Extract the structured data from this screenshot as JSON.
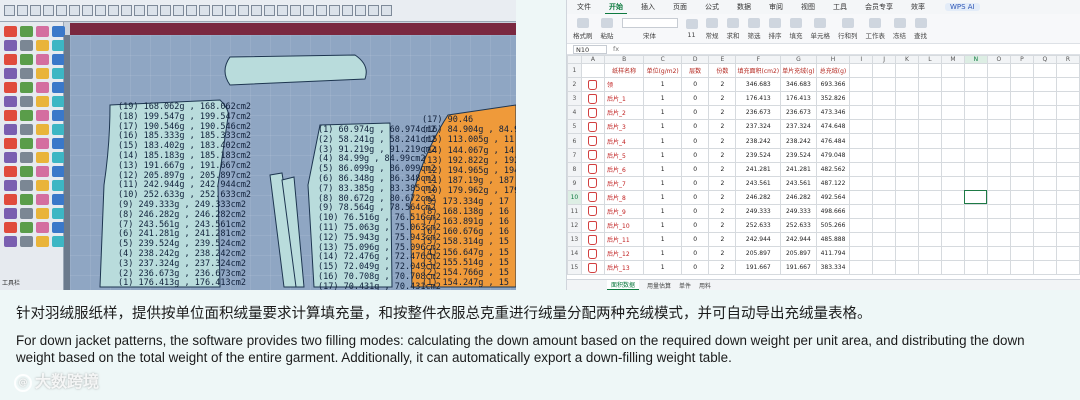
{
  "cad": {
    "status_text": "工具栏",
    "panel_a_rows": [
      "(19) 168.062g , 168.062cm2",
      "(18) 199.547g , 199.547cm2",
      "(17) 190.546g , 190.546cm2",
      "(16) 185.333g , 185.333cm2",
      "(15) 183.402g , 183.402cm2",
      "(14) 185.183g , 185.183cm2",
      "(13) 191.667g , 191.667cm2",
      "(12) 205.897g , 205.897cm2",
      "(11) 242.944g , 242.944cm2",
      "(10) 252.633g , 252.633cm2",
      "(9) 249.333g , 249.333cm2",
      "(8) 246.282g , 246.282cm2",
      "(7) 243.561g , 243.561cm2",
      "(6) 241.281g , 241.281cm2",
      "(5) 239.524g , 239.524cm2",
      "(4) 238.242g , 238.242cm2",
      "(3) 237.324g , 237.324cm2",
      "(2) 236.673g , 236.673cm2",
      "(1) 176.413g , 176.413cm2"
    ],
    "panel_b_rows": [
      "(1) 60.974g , 60.974cm2",
      "(2) 58.241g , 58.241cm2",
      "(3) 91.219g , 91.219cm2",
      "(4) 84.99g , 84.99cm2",
      "(5) 86.099g , 86.099cm2",
      "(6) 86.348g , 86.348cm2",
      "(7) 83.385g , 83.385cm2",
      "(8) 80.672g , 80.672cm2",
      "(9) 78.564g , 78.564cm2",
      "(10) 76.516g , 76.516cm2",
      "(11) 75.063g , 75.063cm2",
      "(12) 75.943g , 75.943cm2",
      "(13) 75.096g , 75.096cm2",
      "(14) 72.476g , 72.476cm2",
      "(15) 72.049g , 72.049cm2",
      "(16) 70.708g , 70.708cm2",
      "(17) 70.431g , 70.431cm2"
    ],
    "panel_c_rows": [
      "(17) 90.46",
      "(16) 84.904g , 84.9",
      "(15) 113.005g , 11",
      "(14) 144.067g , 14",
      "(13) 192.822g , 192",
      "(12) 194.965g , 194",
      "(11) 187.19g , 187",
      "(10) 179.962g , 179",
      "(9) 173.334g , 17",
      "(8) 168.138g , 16",
      "(7) 163.891g , 16",
      "(6) 160.676g , 16",
      "(5) 158.314g , 15",
      "(4) 156.647g , 15",
      "(3) 155.514g , 15",
      "(2) 154.766g , 15",
      "(1) 154.247g , 15"
    ]
  },
  "sheet": {
    "title_tabs": [
      "文件",
      "开始",
      "插入",
      "页面",
      "公式",
      "数据",
      "审阅",
      "视图",
      "工具",
      "会员专享",
      "效率"
    ],
    "active_tab": "开始",
    "wps_label": "WPS AI",
    "ribbon_labels": [
      "格式刷",
      "粘贴",
      "宋体",
      "11",
      "常规",
      "求和",
      "筛选",
      "排序",
      "填充",
      "单元格",
      "行和列",
      "工作表",
      "冻结",
      "查找"
    ],
    "name_box": "N10",
    "fx": "fx",
    "col_headers": [
      "A",
      "B",
      "C",
      "D",
      "E",
      "F",
      "G",
      "H",
      "I",
      "J",
      "K",
      "L",
      "M",
      "N",
      "O",
      "P",
      "Q",
      "R"
    ],
    "selected_col": "N",
    "selected_row": "10",
    "table_header": [
      "纸样名称",
      "单位(g/m2)",
      "层数",
      "份数",
      "填充面积(cm2)",
      "单片充绒(g)",
      "总充绒(g)"
    ],
    "rows": [
      {
        "num": "2",
        "name": "领",
        "unit": "1",
        "layer": "0",
        "copies": "2",
        "area": "346.683",
        "single": "346.683",
        "total": "693.366"
      },
      {
        "num": "3",
        "name": "后片_1",
        "unit": "1",
        "layer": "0",
        "copies": "2",
        "area": "176.413",
        "single": "176.413",
        "total": "352.826"
      },
      {
        "num": "4",
        "name": "后片_2",
        "unit": "1",
        "layer": "0",
        "copies": "2",
        "area": "236.673",
        "single": "236.673",
        "total": "473.346"
      },
      {
        "num": "5",
        "name": "后片_3",
        "unit": "1",
        "layer": "0",
        "copies": "2",
        "area": "237.324",
        "single": "237.324",
        "total": "474.648"
      },
      {
        "num": "6",
        "name": "后片_4",
        "unit": "1",
        "layer": "0",
        "copies": "2",
        "area": "238.242",
        "single": "238.242",
        "total": "476.484"
      },
      {
        "num": "7",
        "name": "后片_5",
        "unit": "1",
        "layer": "0",
        "copies": "2",
        "area": "239.524",
        "single": "239.524",
        "total": "479.048"
      },
      {
        "num": "8",
        "name": "后片_6",
        "unit": "1",
        "layer": "0",
        "copies": "2",
        "area": "241.281",
        "single": "241.281",
        "total": "482.562"
      },
      {
        "num": "9",
        "name": "后片_7",
        "unit": "1",
        "layer": "0",
        "copies": "2",
        "area": "243.561",
        "single": "243.561",
        "total": "487.122"
      },
      {
        "num": "10",
        "name": "后片_8",
        "unit": "1",
        "layer": "0",
        "copies": "2",
        "area": "246.282",
        "single": "246.282",
        "total": "492.564"
      },
      {
        "num": "11",
        "name": "后片_9",
        "unit": "1",
        "layer": "0",
        "copies": "2",
        "area": "249.333",
        "single": "249.333",
        "total": "498.666"
      },
      {
        "num": "12",
        "name": "后片_10",
        "unit": "1",
        "layer": "0",
        "copies": "2",
        "area": "252.633",
        "single": "252.633",
        "total": "505.266"
      },
      {
        "num": "13",
        "name": "后片_11",
        "unit": "1",
        "layer": "0",
        "copies": "2",
        "area": "242.944",
        "single": "242.944",
        "total": "485.888"
      },
      {
        "num": "14",
        "name": "后片_12",
        "unit": "1",
        "layer": "0",
        "copies": "2",
        "area": "205.897",
        "single": "205.897",
        "total": "411.794"
      },
      {
        "num": "15",
        "name": "后片_13",
        "unit": "1",
        "layer": "0",
        "copies": "2",
        "area": "191.667",
        "single": "191.667",
        "total": "383.334"
      }
    ],
    "sheet_tabs": [
      "面积数据",
      "用量估算",
      "单件",
      "用料"
    ],
    "active_sheet": "面积数据"
  },
  "caption": {
    "zh": "针对羽绒服纸样，提供按单位面积绒量要求计算填充量，和按整件衣服总克重进行绒量分配两种充绒模式，并可自动导出充绒量表格。",
    "en": "For down jacket patterns, the software provides two filling modes: calculating the down amount based on the required down weight per unit area, and distributing the down weight based on the total weight of the entire garment. Additionally, it can automatically export a down-filling weight table."
  },
  "watermark": {
    "text": "大数跨境",
    "at": "@"
  },
  "colors": {
    "pattern_fill": "#b9dcdc",
    "pattern_orange": "#ef9a3a",
    "canvas_bg": "#8fa6c3",
    "ruler": "#7a2840",
    "accent_green": "#0e7a3f",
    "red_text": "#c01d1d"
  }
}
